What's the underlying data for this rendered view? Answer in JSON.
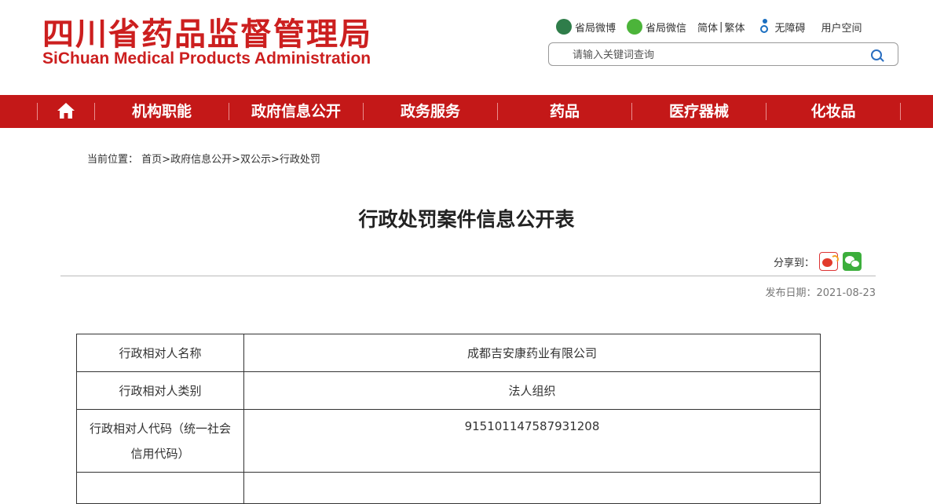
{
  "header": {
    "logo_cn": "四川省药品监督管理局",
    "logo_en": "SiChuan Medical Products Administration",
    "top_links": {
      "weibo": "省局微博",
      "wechat": "省局微信",
      "simplified": "简体",
      "separator": "|",
      "traditional": "繁体",
      "accessibility": "无障碍",
      "user_space": "用户空间"
    },
    "search": {
      "placeholder": "请输入关键词查询"
    }
  },
  "nav": {
    "home_icon": "home-icon",
    "items": [
      "机构职能",
      "政府信息公开",
      "政务服务",
      "药品",
      "医疗器械",
      "化妆品"
    ]
  },
  "breadcrumb": {
    "prefix": "当前位置：",
    "items": [
      "首页",
      "政府信息公开",
      "双公示",
      "行政处罚"
    ],
    "separator": ">"
  },
  "article": {
    "title": "行政处罚案件信息公开表",
    "share_label": "分享到：",
    "pub_date": "发布日期：2021-08-23"
  },
  "table": {
    "rows": [
      {
        "label": "行政相对人名称",
        "value": "成都吉安康药业有限公司"
      },
      {
        "label": "行政相对人类别",
        "value": "法人组织"
      },
      {
        "label": "行政相对人代码（统一社会信用代码）",
        "value": "91510114758793120 8"
      }
    ]
  },
  "colors": {
    "brand_red": "#c41818",
    "logo_red": "#cc1f1f"
  }
}
